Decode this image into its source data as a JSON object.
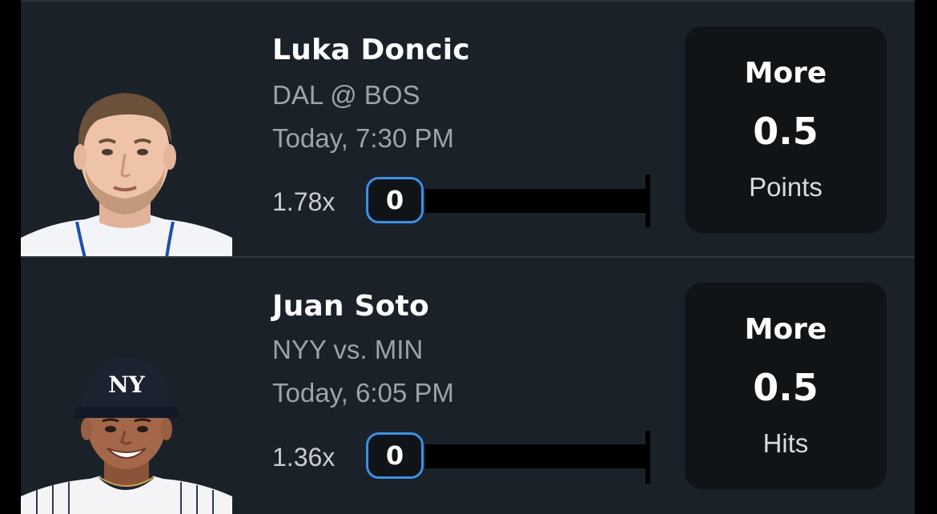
{
  "picks": [
    {
      "player_name": "Luka Doncic",
      "matchup": "DAL @ BOS",
      "game_time": "Today, 7:30 PM",
      "multiplier": "1.78x",
      "progress_value": "0",
      "progress_fraction": 0,
      "direction": "More",
      "line": "0.5",
      "stat": "Points"
    },
    {
      "player_name": "Juan Soto",
      "matchup": "NYY vs. MIN",
      "game_time": "Today, 6:05 PM",
      "multiplier": "1.36x",
      "progress_value": "0",
      "progress_fraction": 0,
      "direction": "More",
      "line": "0.5",
      "stat": "Hits"
    }
  ],
  "colors": {
    "card_bg": "#1a2129",
    "accent_blue": "#3d8fe6",
    "pick_box_bg": "#111417",
    "secondary_text": "#9ca3ab"
  },
  "icons": [
    "player-headshot-luka",
    "player-headshot-soto"
  ]
}
